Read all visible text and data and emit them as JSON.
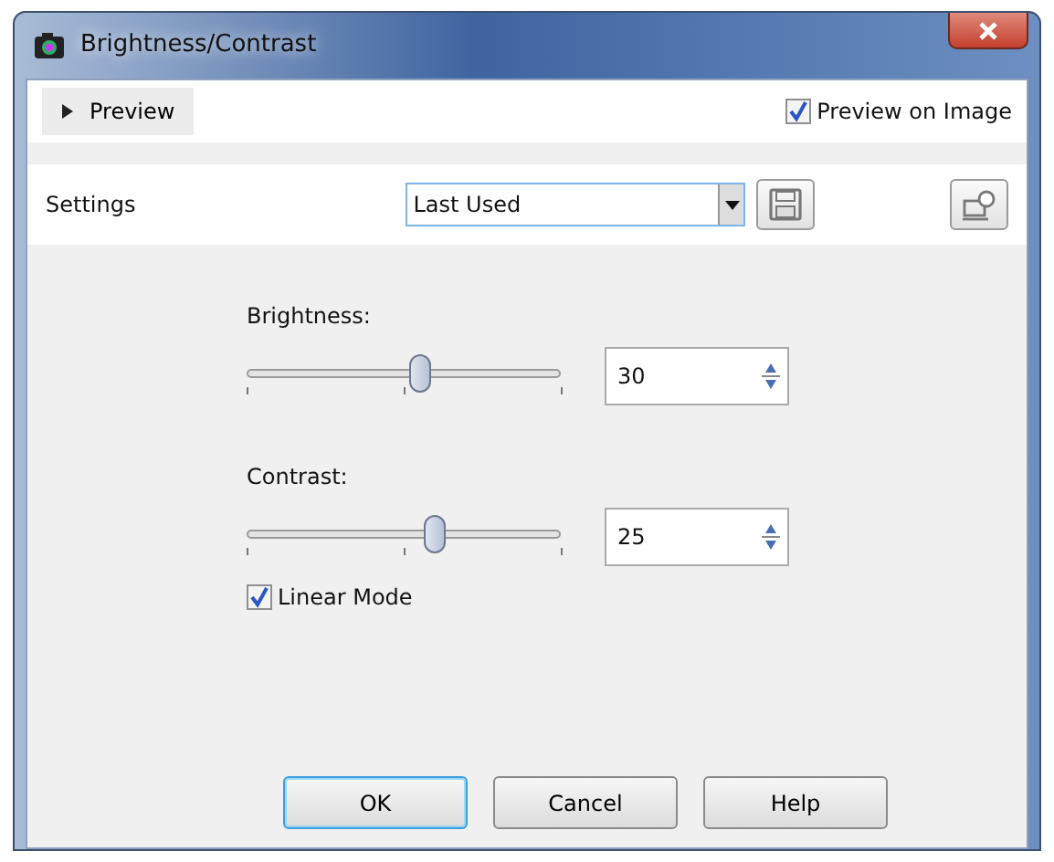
{
  "window": {
    "title": "Brightness/Contrast"
  },
  "preview": {
    "label": "Preview",
    "expanded": false
  },
  "preview_on_image": {
    "label": "Preview on Image",
    "checked": true
  },
  "settings": {
    "label": "Settings",
    "value": "Last Used"
  },
  "sliders": [
    {
      "label": "Brightness:",
      "level": 0.55,
      "value": "30"
    },
    {
      "label": "Contrast:",
      "level": 0.6,
      "value": "25"
    }
  ],
  "linear_mode": {
    "label": "Linear Mode",
    "checked": true
  },
  "buttons": [
    {
      "label": "OK",
      "default": true
    },
    {
      "label": "Cancel",
      "default": false
    },
    {
      "label": "Help",
      "default": false
    }
  ]
}
